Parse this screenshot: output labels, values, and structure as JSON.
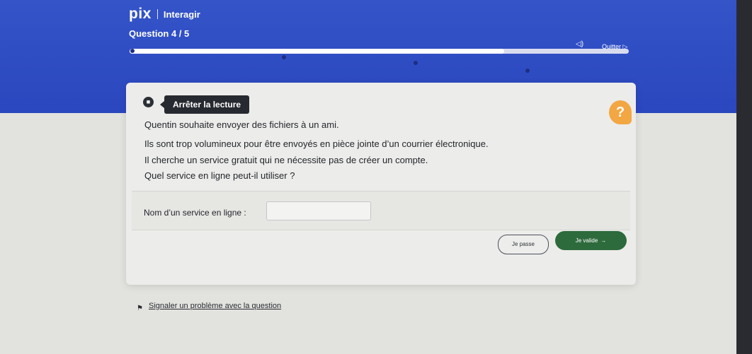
{
  "header": {
    "logo": "pix",
    "app_name": "Interagir",
    "question_counter": "Question 4 / 5",
    "audio_icon": "speaker-icon",
    "quit_label": "Quitter ▷",
    "colors": {
      "band": "#2b47bf",
      "dots": "#1d2e84"
    },
    "progress": {
      "current": 4,
      "total": 5
    }
  },
  "reader": {
    "icon": "stop-reading-icon",
    "tooltip_label": "Arrêter la lecture"
  },
  "help": {
    "icon": "question-mark-icon",
    "label": "?"
  },
  "question": {
    "lines": [
      "Quentin souhaite envoyer des fichiers à un ami.",
      "Ils sont trop volumineux pour être envoyés en pièce jointe d’un courrier électronique.",
      "Il cherche un service gratuit qui ne nécessite pas de créer un compte.",
      "Quel service en ligne peut-il utiliser ?"
    ]
  },
  "answer": {
    "label": "Nom d’un service en ligne :",
    "value": ""
  },
  "actions": {
    "skip_label": "Je passe",
    "validate_label": "Je valide",
    "validate_icon": "arrow-right-icon",
    "validate_color": "#2d6a3c"
  },
  "footer": {
    "flag_icon": "flag-icon",
    "report_label": "Signaler un problème avec la question"
  }
}
